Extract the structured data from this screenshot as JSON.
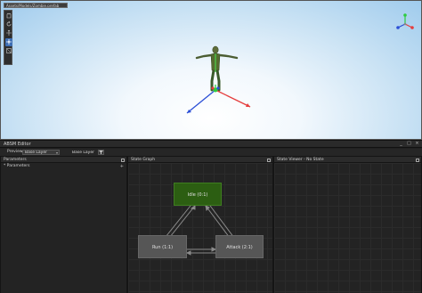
{
  "viewport": {
    "tab_label": "Assets/Models/Zombie.prefab",
    "tools": [
      "hand-tool",
      "rotate-view-tool",
      "move-tool",
      "transform-tool",
      "rect-tool"
    ],
    "active_tool": 3,
    "colors": {
      "x_axis": "#e53d3d",
      "y_axis": "#2ecc40",
      "z_axis": "#2b4fd6",
      "sky": "#9fcbed"
    }
  },
  "editor": {
    "title": "ABSM Editor",
    "window_buttons": [
      "_",
      "□",
      "×"
    ],
    "toolbar": {
      "preview_label": "Preview",
      "layer_dropdown": "Base Layer",
      "layer_dropdown_2": "Base Layer",
      "filter_icon": "filter-icon"
    },
    "parameters_panel": {
      "title": "Parameters",
      "row_label": "* Parameters",
      "add_label": "+"
    },
    "state_graph": {
      "title": "State Graph",
      "states": [
        {
          "id": "idle",
          "label": "Idle (0:1)",
          "color": "#2c5e12"
        },
        {
          "id": "run",
          "label": "Run (1:1)",
          "color": "#565656"
        },
        {
          "id": "attack",
          "label": "Attack (2:1)",
          "color": "#565656"
        }
      ]
    },
    "state_viewer": {
      "title": "State Viewer - No State"
    }
  }
}
